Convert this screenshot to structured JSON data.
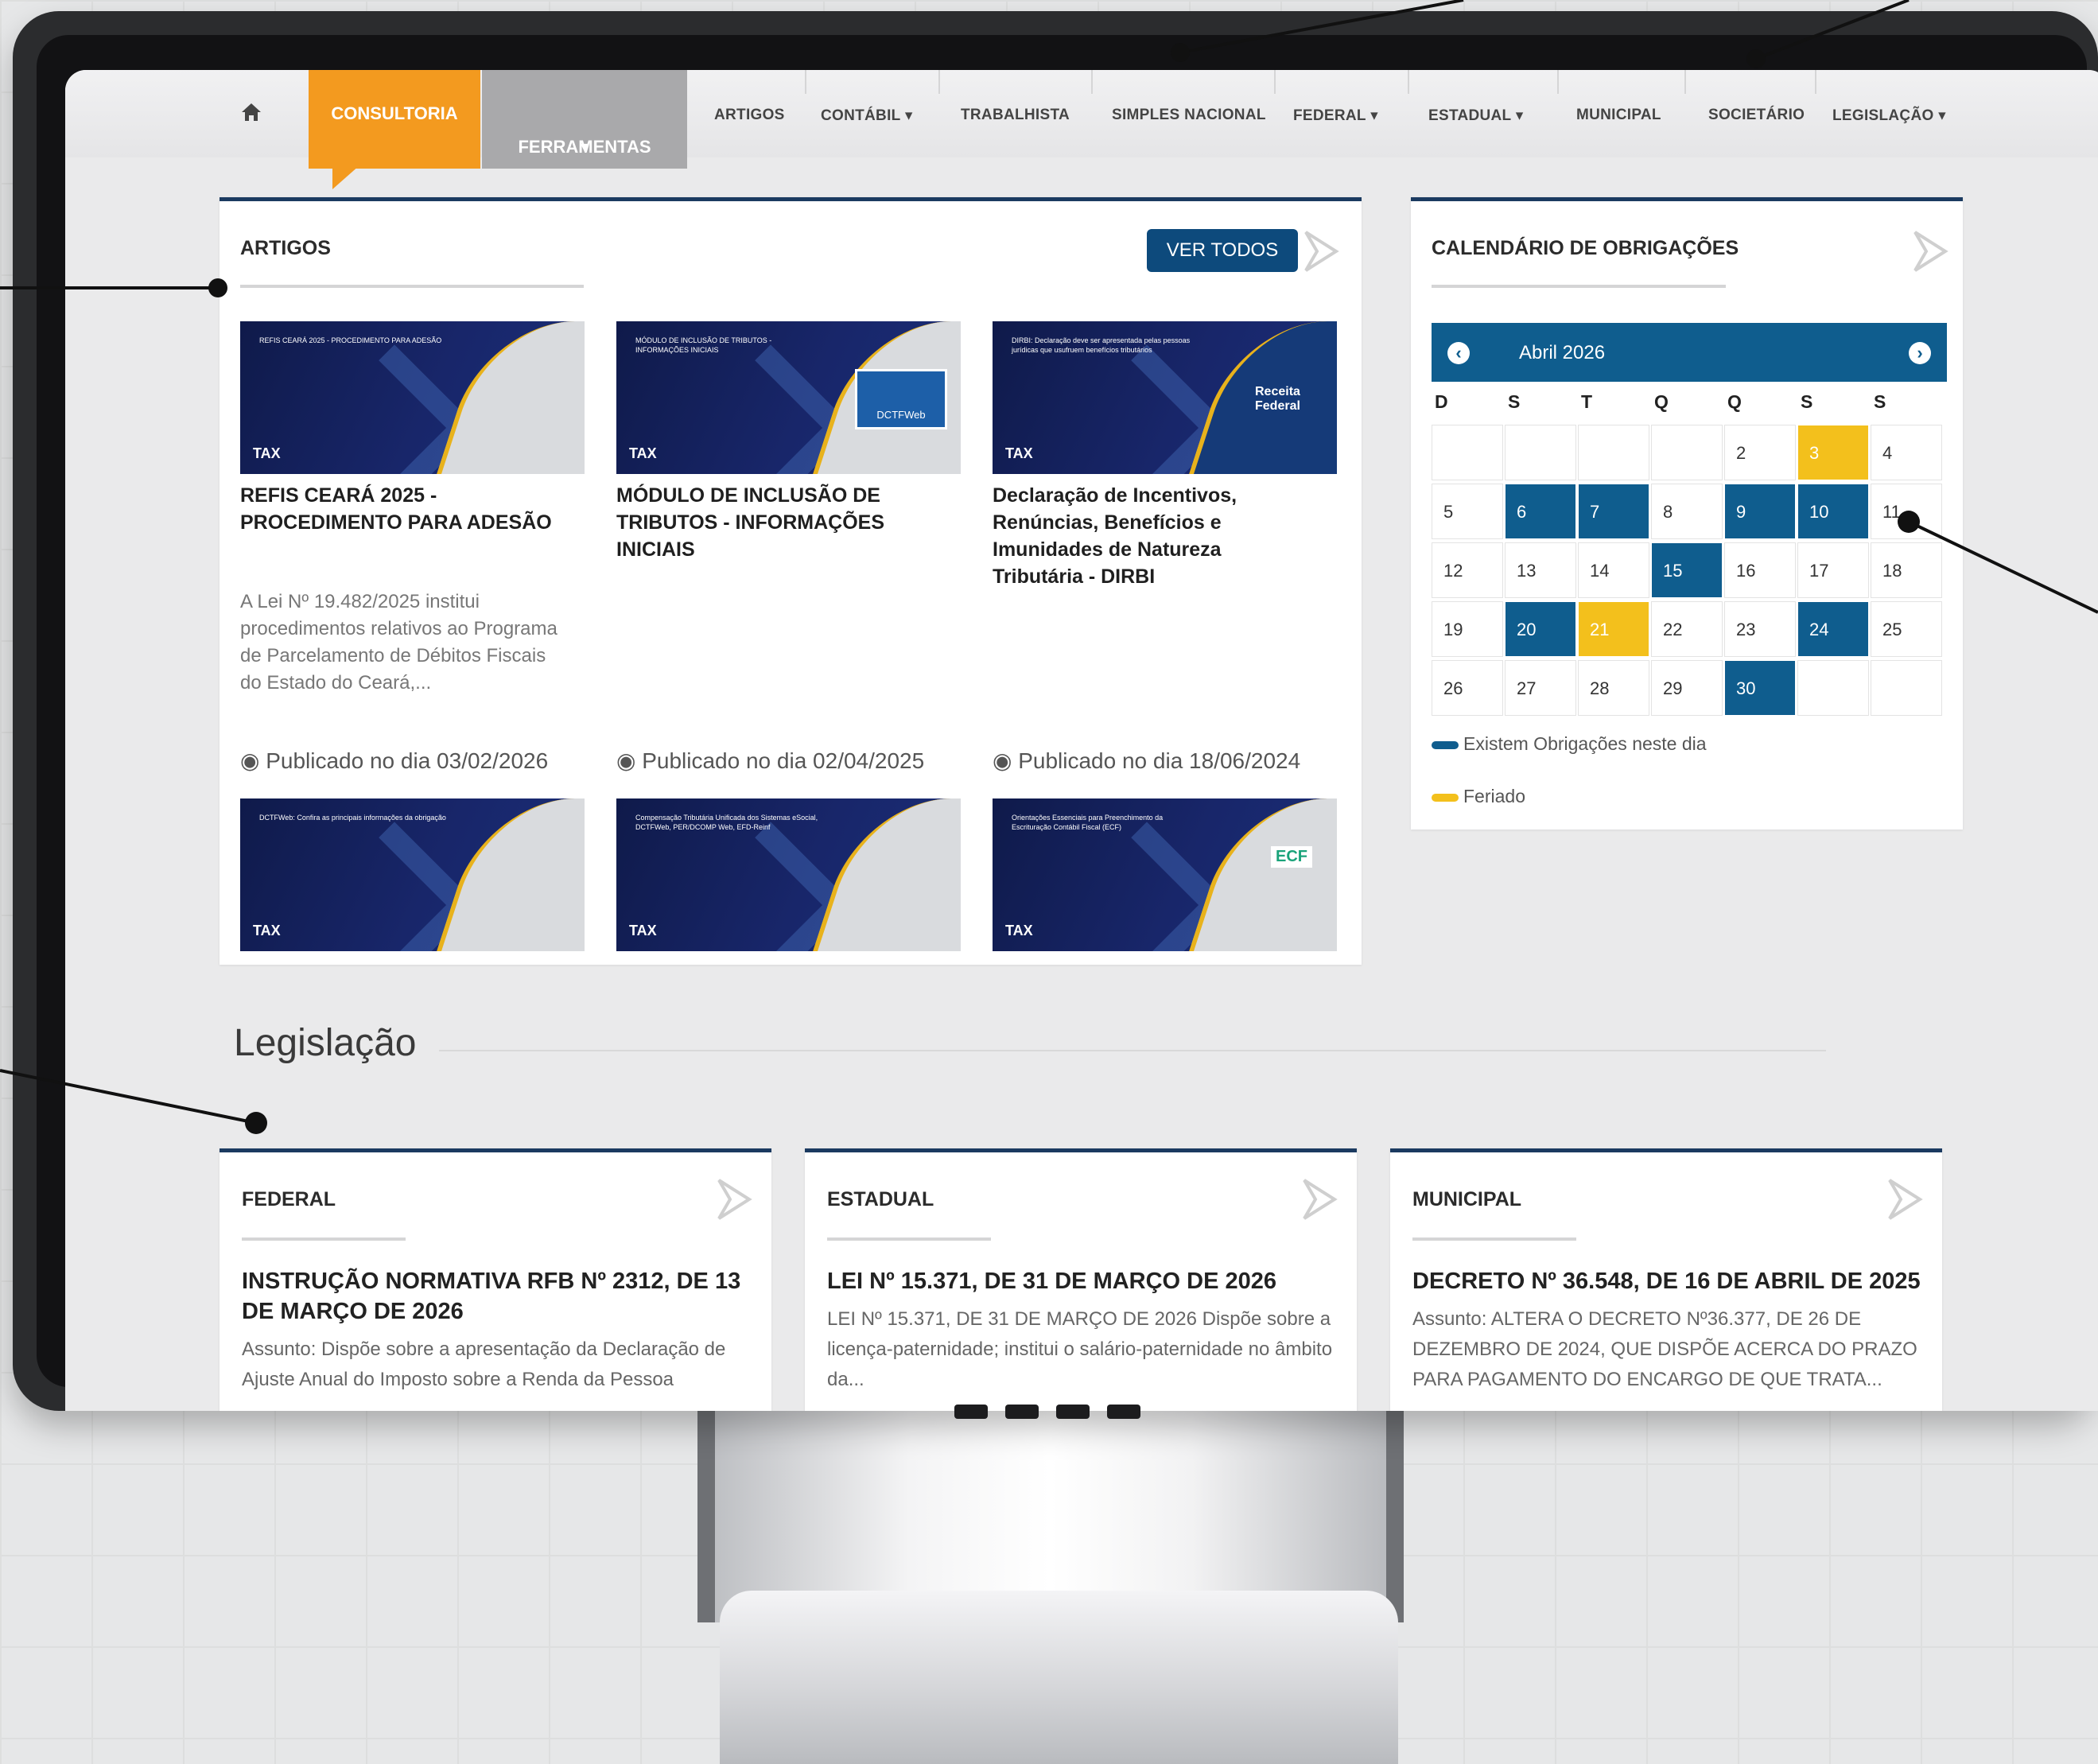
{
  "nav": {
    "home_icon": "home-icon",
    "consultoria": "CONSULTORIA",
    "ferramentas": "FERRAMENTAS",
    "items": [
      "ARTIGOS",
      "CONTÁBIL",
      "TRABALHISTA",
      "SIMPLES NACIONAL",
      "FEDERAL",
      "ESTADUAL",
      "MUNICIPAL",
      "SOCIETÁRIO",
      "LEGISLAÇÃO"
    ],
    "chevron": "⌄"
  },
  "artigos": {
    "title": "ARTIGOS",
    "ver_todos": "VER TODOS",
    "cards": [
      {
        "thumb_heading": "REFIS CEARÁ 2025 - PROCEDIMENTO PARA ADESÃO",
        "title": "REFIS CEARÁ 2025 - PROCEDIMENTO PARA ADESÃO",
        "excerpt": "A Lei Nº 19.482/2025 institui procedimentos relativos ao Programa de Parcelamento de Débitos Fiscais do Estado do Ceará,...",
        "date": "Publicado no dia 03/02/2026"
      },
      {
        "thumb_heading": "MÓDULO DE INCLUSÃO DE TRIBUTOS - INFORMAÇÕES INICIAIS",
        "thumb_badge": "DCTFWeb",
        "title": "MÓDULO DE INCLUSÃO DE TRIBUTOS - INFORMAÇÕES INICIAIS",
        "date": "Publicado no dia 02/04/2025"
      },
      {
        "thumb_heading": "DIRBI: Declaração deve ser apresentada pelas pessoas jurídicas que usufruem benefícios tributários",
        "thumb_badge": "Receita Federal",
        "title": "Declaração de Incentivos, Renúncias, Benefícios e Imunidades de Natureza Tributária - DIRBI",
        "date": "Publicado no dia 18/06/2024"
      }
    ],
    "thumbs_row2": [
      {
        "heading": "DCTFWeb: Confira as principais informações da obrigação"
      },
      {
        "heading": "Compensação Tributária Unificada dos Sistemas eSocial, DCTFWeb, PER/DCOMP Web, EFD-Reinf"
      },
      {
        "heading": "Orientações Essenciais para Preenchimento da Escrituração Contábil Fiscal (ECF)",
        "badge": "ECF"
      }
    ],
    "logo": "TAX"
  },
  "calendario": {
    "title": "CALENDÁRIO DE OBRIGAÇÕES",
    "month": "Abril 2026",
    "prev_icon": "arrow-left-circle-icon",
    "next_icon": "arrow-right-circle-icon",
    "dow": [
      "D",
      "S",
      "T",
      "Q",
      "Q",
      "S",
      "S"
    ],
    "weeks": [
      [
        null,
        null,
        null,
        null,
        "2",
        "3",
        "4"
      ],
      [
        "5",
        "6",
        "7",
        "8",
        "9",
        "10",
        "11"
      ],
      [
        "12",
        "13",
        "14",
        "15",
        "16",
        "17",
        "18"
      ],
      [
        "19",
        "20",
        "21",
        "22",
        "23",
        "24",
        "25"
      ],
      [
        "26",
        "27",
        "28",
        "29",
        "30",
        null,
        null
      ]
    ],
    "obrigacao_days": [
      "6",
      "7",
      "9",
      "10",
      "15",
      "20",
      "24",
      "30"
    ],
    "feriado_days": [
      "3",
      "21"
    ],
    "legend_obrigacoes": "Existem Obrigações neste dia",
    "legend_feriado": "Feriado",
    "colors": {
      "obrigacao": "#0f5d8e",
      "feriado": "#f3c01c"
    }
  },
  "legislacao": {
    "section_title": "Legislação",
    "cards": [
      {
        "heading": "FEDERAL",
        "title": "INSTRUÇÃO NORMATIVA RFB Nº 2312, DE 13 DE MARÇO DE 2026",
        "text": "Assunto: Dispõe sobre a apresentação da Declaração de Ajuste Anual do Imposto sobre a Renda da Pessoa"
      },
      {
        "heading": "ESTADUAL",
        "title": "LEI Nº 15.371, DE 31 DE MARÇO DE 2026",
        "text": "LEI Nº 15.371, DE 31 DE MARÇO DE 2026 Dispõe sobre a licença-paternidade; institui o salário-paternidade no âmbito da..."
      },
      {
        "heading": "MUNICIPAL",
        "title": "DECRETO Nº 36.548, DE 16 DE ABRIL DE 2025",
        "text": "Assunto: ALTERA O DECRETO Nº36.377, DE 26 DE DEZEMBRO DE 2024, QUE DISPÕE ACERCA DO PRAZO PARA PAGAMENTO DO ENCARGO DE QUE TRATA..."
      }
    ]
  },
  "colors": {
    "accent_orange": "#f39a1f",
    "navy": "#1b3a60",
    "blue": "#0d4a7c"
  }
}
